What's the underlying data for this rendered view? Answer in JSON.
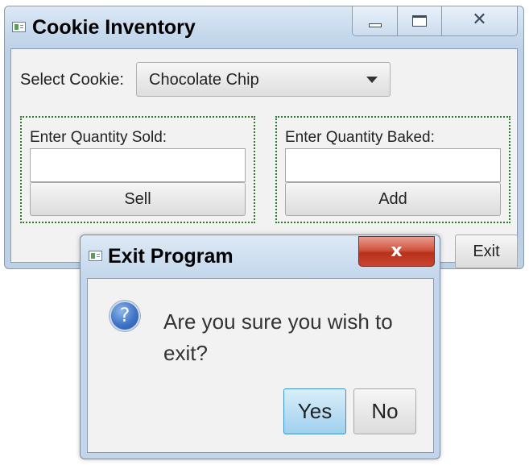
{
  "main_window": {
    "title": "Cookie Inventory",
    "icons": {
      "app": "app-window-icon",
      "minimize": "minimize-icon",
      "maximize": "maximize-icon",
      "close": "close-icon"
    },
    "close_glyph": "✕",
    "select_label": "Select Cookie:",
    "cookie_combo": {
      "selected": "Chocolate Chip",
      "arrow_icon": "chevron-down-icon"
    },
    "sold_group": {
      "label": "Enter Quantity Sold:",
      "input_value": "",
      "button_label": "Sell"
    },
    "baked_group": {
      "label": "Enter Quantity Baked:",
      "input_value": "",
      "button_label": "Add"
    },
    "exit_label": "Exit"
  },
  "dialog": {
    "title": "Exit Program",
    "close_glyph": "x",
    "icon": "question-icon",
    "icon_glyph": "?",
    "message": "Are you sure you wish to exit?",
    "yes_label": "Yes",
    "no_label": "No"
  },
  "colors": {
    "group_border": "#2a7a2a",
    "close_button_red": "#c9452f",
    "default_button": "#9fd0ee",
    "question_icon": "#3f74c6"
  }
}
